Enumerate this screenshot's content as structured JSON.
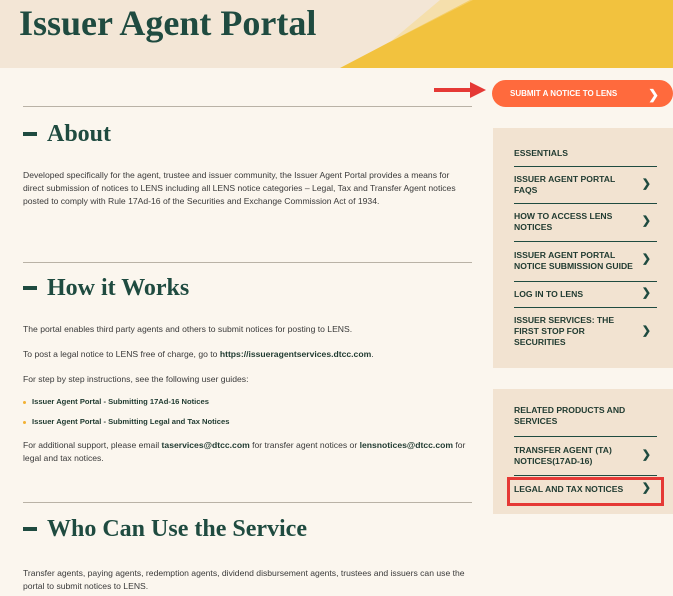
{
  "header": {
    "title": "Issuer Agent Portal"
  },
  "actions": {
    "submit_notice": "SUBMIT A NOTICE TO LENS"
  },
  "about": {
    "title": "About",
    "text": "Developed specifically for the agent, trustee and issuer community, the Issuer Agent Portal provides a means for direct submission of notices to LENS including all LENS notice categories – Legal, Tax and Transfer Agent notices posted to comply with Rule 17Ad-16 of the Securities and Exchange Commission Act of 1934."
  },
  "how": {
    "title": "How it Works",
    "p1": "The portal enables third party agents and others to submit notices for posting to LENS.",
    "p2_prefix": "To post a legal notice to LENS free of charge, go to ",
    "p2_link": "https://issueragentservices.dtcc.com",
    "p2_suffix": ".",
    "p3": "For step by step instructions, see the following user guides:",
    "guides": [
      "Issuer Agent Portal - Submitting 17Ad-16 Notices",
      "Issuer Agent Portal - Submitting Legal and Tax Notices"
    ],
    "p4_prefix": "For additional support, please email ",
    "p4_email1": "taservices@dtcc.com",
    "p4_mid": " for transfer agent notices or ",
    "p4_email2": "lensnotices@dtcc.com",
    "p4_suffix": " for legal and tax notices."
  },
  "who": {
    "title": "Who Can Use the Service",
    "text": "Transfer agents, paying agents, redemption agents, dividend disbursement agents, trustees and issuers can use the portal to submit notices to LENS."
  },
  "sidebar": {
    "essentials": {
      "heading": "ESSENTIALS",
      "items": [
        {
          "label": "ISSUER AGENT PORTAL FAQS"
        },
        {
          "label": "HOW TO ACCESS LENS NOTICES"
        },
        {
          "label": "ISSUER AGENT PORTAL NOTICE SUBMISSION GUIDE"
        },
        {
          "label": "LOG IN TO LENS"
        },
        {
          "label": "ISSUER SERVICES: THE FIRST STOP FOR SECURITIES"
        }
      ]
    },
    "related": {
      "heading": "RELATED PRODUCTS AND SERVICES",
      "items": [
        {
          "label": "TRANSFER AGENT (TA) NOTICES(17AD-16)"
        },
        {
          "label": "LEGAL AND TAX NOTICES"
        }
      ]
    }
  },
  "colors": {
    "brand": "#1f4b40",
    "accent": "#ff6a3d",
    "yellow": "#f2c23e",
    "highlight": "#e53935"
  },
  "icons": {
    "chevron": "chevron-right-icon",
    "pointer": "red-arrow-icon"
  }
}
